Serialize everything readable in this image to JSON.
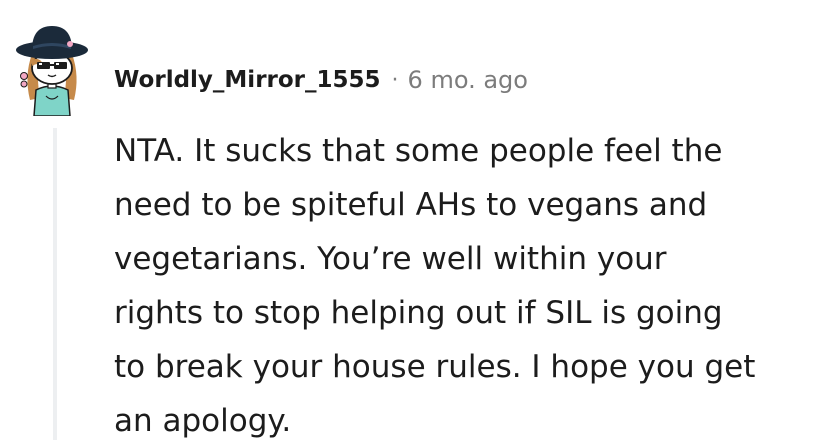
{
  "comment": {
    "author": "Worldly_Mirror_1555",
    "separator": "·",
    "timestamp": "6 mo. ago",
    "avatar_icon": "snoo-avatar-icon",
    "body_lines": [
      "NTA. It sucks that some people feel the",
      "need to be spiteful AHs to vegans and",
      "vegetarians. You’re well within your",
      "rights to stop helping out if SIL is going",
      "to break your house rules. I hope you get",
      "an apology."
    ]
  },
  "colors": {
    "text": "#1c1c1c",
    "meta": "#7c7c7c",
    "thread_line": "#edeff1",
    "avatar_hat": "#1b2a3a",
    "avatar_hair": "#c68a4a",
    "avatar_top": "#7fd4c8"
  }
}
